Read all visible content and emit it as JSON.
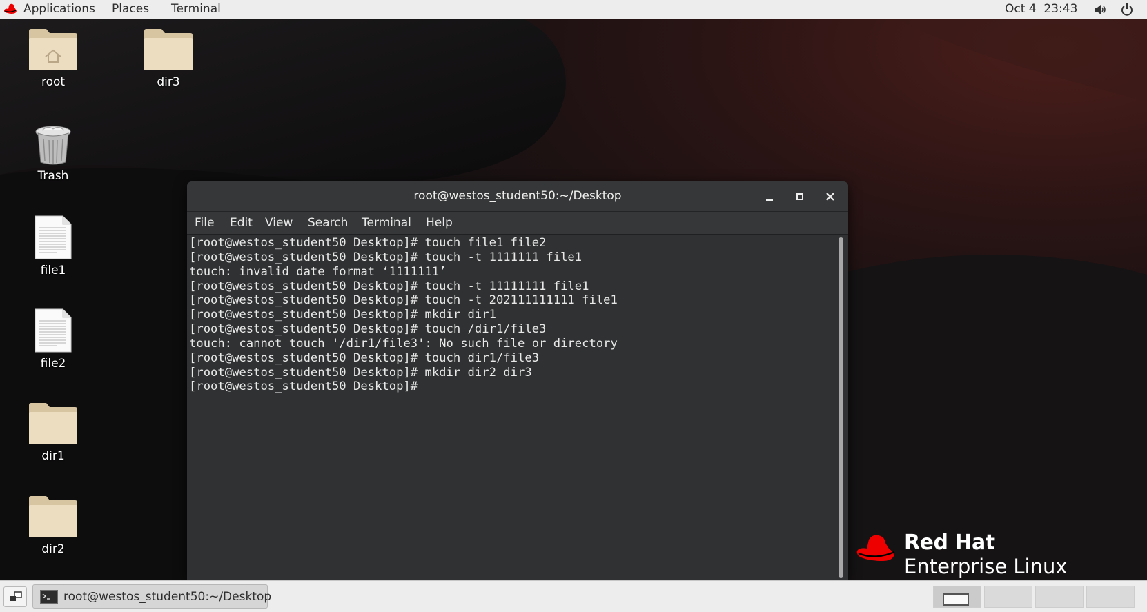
{
  "top_panel": {
    "menus": [
      {
        "label": "Applications"
      },
      {
        "label": "Places"
      },
      {
        "label": "Terminal"
      }
    ],
    "clock": "Oct 4  23:43",
    "icons": [
      "redhat-menu-icon",
      "volume-icon",
      "power-icon"
    ]
  },
  "desktop": {
    "icons": [
      {
        "label": "root",
        "icon": "home-folder-icon"
      },
      {
        "label": "dir3",
        "icon": "folder-icon"
      },
      {
        "label": "Trash",
        "icon": "trash-icon"
      },
      {
        "label": "file1",
        "icon": "text-file-icon"
      },
      {
        "label": "file2",
        "icon": "text-file-icon"
      },
      {
        "label": "dir1",
        "icon": "folder-icon"
      },
      {
        "label": "dir2",
        "icon": "folder-icon"
      }
    ]
  },
  "terminal": {
    "title": "root@westos_student50:~/Desktop",
    "menu": [
      {
        "label": "File"
      },
      {
        "label": "Edit"
      },
      {
        "label": "View"
      },
      {
        "label": "Search"
      },
      {
        "label": "Terminal"
      },
      {
        "label": "Help"
      }
    ],
    "lines": [
      "[root@westos_student50 Desktop]# touch file1 file2",
      "[root@westos_student50 Desktop]# touch -t 1111111 file1",
      "touch: invalid date format ‘1111111’",
      "[root@westos_student50 Desktop]# touch -t 11111111 file1",
      "[root@westos_student50 Desktop]# touch -t 202111111111 file1",
      "[root@westos_student50 Desktop]# mkdir dir1",
      "[root@westos_student50 Desktop]# touch /dir1/file3",
      "touch: cannot touch '/dir1/file3': No such file or directory",
      "[root@westos_student50 Desktop]# touch dir1/file3",
      "[root@westos_student50 Desktop]# mkdir dir2 dir3",
      "[root@westos_student50 Desktop]# "
    ]
  },
  "logo": {
    "line1": "Red Hat",
    "line2": "Enterprise Linux"
  },
  "bottom_panel": {
    "task_label": "root@westos_student50:~/Desktop",
    "workspace_count": 4,
    "active_workspace": 1
  },
  "colors": {
    "redhat_red": "#ee0000",
    "terminal_bg": "#2f3132",
    "panel_bg": "#ededed",
    "folder_tan": "#e8d9bd"
  }
}
